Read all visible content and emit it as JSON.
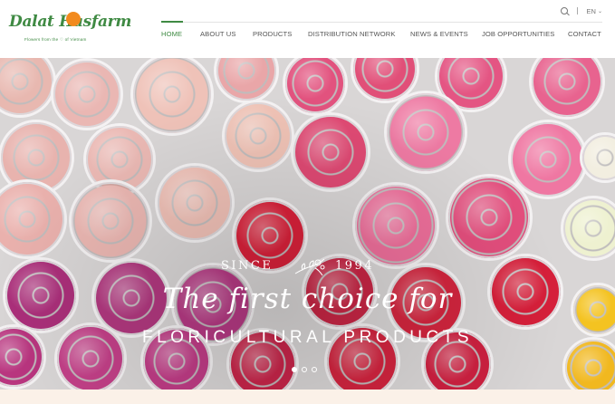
{
  "brand": {
    "name": "Dalat Hasfarm",
    "tagline": "Flowers from the ♡ of Vietnam",
    "green": "#3f8a43",
    "orange": "#f28a1e"
  },
  "topbar": {
    "search_icon": "search-icon",
    "language": "EN",
    "language_icon": "chevron-down-icon"
  },
  "nav": {
    "items": [
      {
        "label": "HOME",
        "active": true
      },
      {
        "label": "ABOUT US",
        "active": false
      },
      {
        "label": "PRODUCTS",
        "active": false
      },
      {
        "label": "DISTRIBUTION NETWORK",
        "active": false
      },
      {
        "label": "NEWS & EVENTS",
        "active": false
      },
      {
        "label": "JOB OPPORTUNITIES",
        "active": false
      },
      {
        "label": "CONTACT",
        "active": false
      }
    ]
  },
  "hero": {
    "since_label": "SINCE",
    "year": "1994",
    "headline": "The first choice for",
    "subheadline": "FLORICULTURAL PRODUCTS",
    "slides": {
      "count": 3,
      "active": 1
    }
  }
}
